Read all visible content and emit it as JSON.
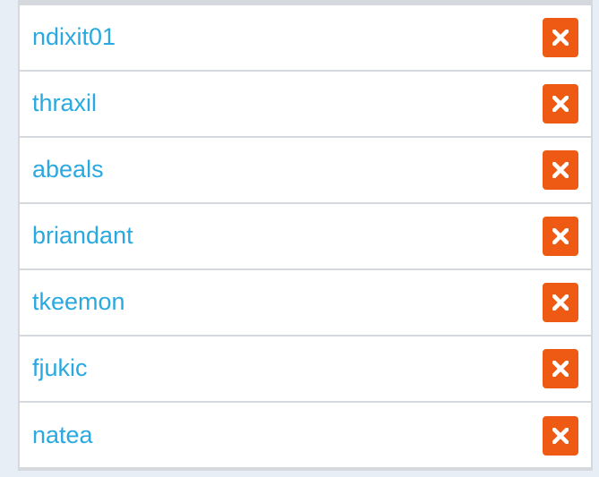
{
  "users": [
    {
      "username": "ndixit01"
    },
    {
      "username": "thraxil"
    },
    {
      "username": "abeals"
    },
    {
      "username": "briandant"
    },
    {
      "username": "tkeemon"
    },
    {
      "username": "fjukic"
    },
    {
      "username": "natea"
    }
  ],
  "colors": {
    "link": "#29a9e0",
    "remove_button": "#ee5a14",
    "page_background": "#e8eef6",
    "border": "#d5d9de"
  },
  "icons": {
    "remove": "close-icon"
  }
}
